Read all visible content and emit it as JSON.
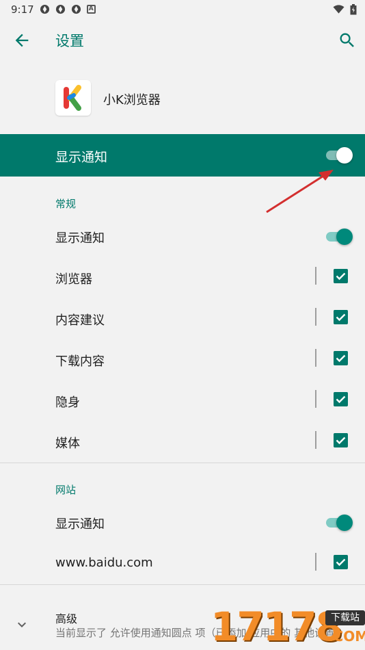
{
  "status_bar": {
    "time": "9:17",
    "notif_icons": [
      "app-notif-icon",
      "app-notif-icon",
      "app-notif-icon"
    ],
    "a_badge": "A",
    "right_icons": [
      "wifi-icon",
      "battery-icon"
    ]
  },
  "toolbar": {
    "back_icon": "arrow-left-icon",
    "title": "设置",
    "search_icon": "search-icon"
  },
  "app": {
    "icon": "k-browser-logo",
    "name": "小K浏览器"
  },
  "master_toggle": {
    "label": "显示通知",
    "on": true
  },
  "general": {
    "header": "常规",
    "toggle_row": {
      "label": "显示通知",
      "on": true
    },
    "channels": [
      {
        "label": "浏览器",
        "checked": true
      },
      {
        "label": "内容建议",
        "checked": true
      },
      {
        "label": "下载内容",
        "checked": true
      },
      {
        "label": "隐身",
        "checked": true
      },
      {
        "label": "媒体",
        "checked": true
      }
    ]
  },
  "sites": {
    "header": "网站",
    "toggle_row": {
      "label": "显示通知",
      "on": true
    },
    "items": [
      {
        "label": "www.baidu.com",
        "checked": true
      }
    ]
  },
  "advanced": {
    "icon": "chevron-down-icon",
    "title": "高级",
    "summary": "当前显示了 允许使用通知圆点 项（已添加 应用中的 其他设置"
  },
  "watermark": {
    "number": "17178",
    "tag": "下载站",
    "suffix": ".COM"
  },
  "colors": {
    "accent": "#00796b",
    "accent_light": "#80cbc4",
    "background": "#f2f2f2",
    "annotation_arrow": "#d32f2f",
    "watermark": "#f28c28"
  }
}
